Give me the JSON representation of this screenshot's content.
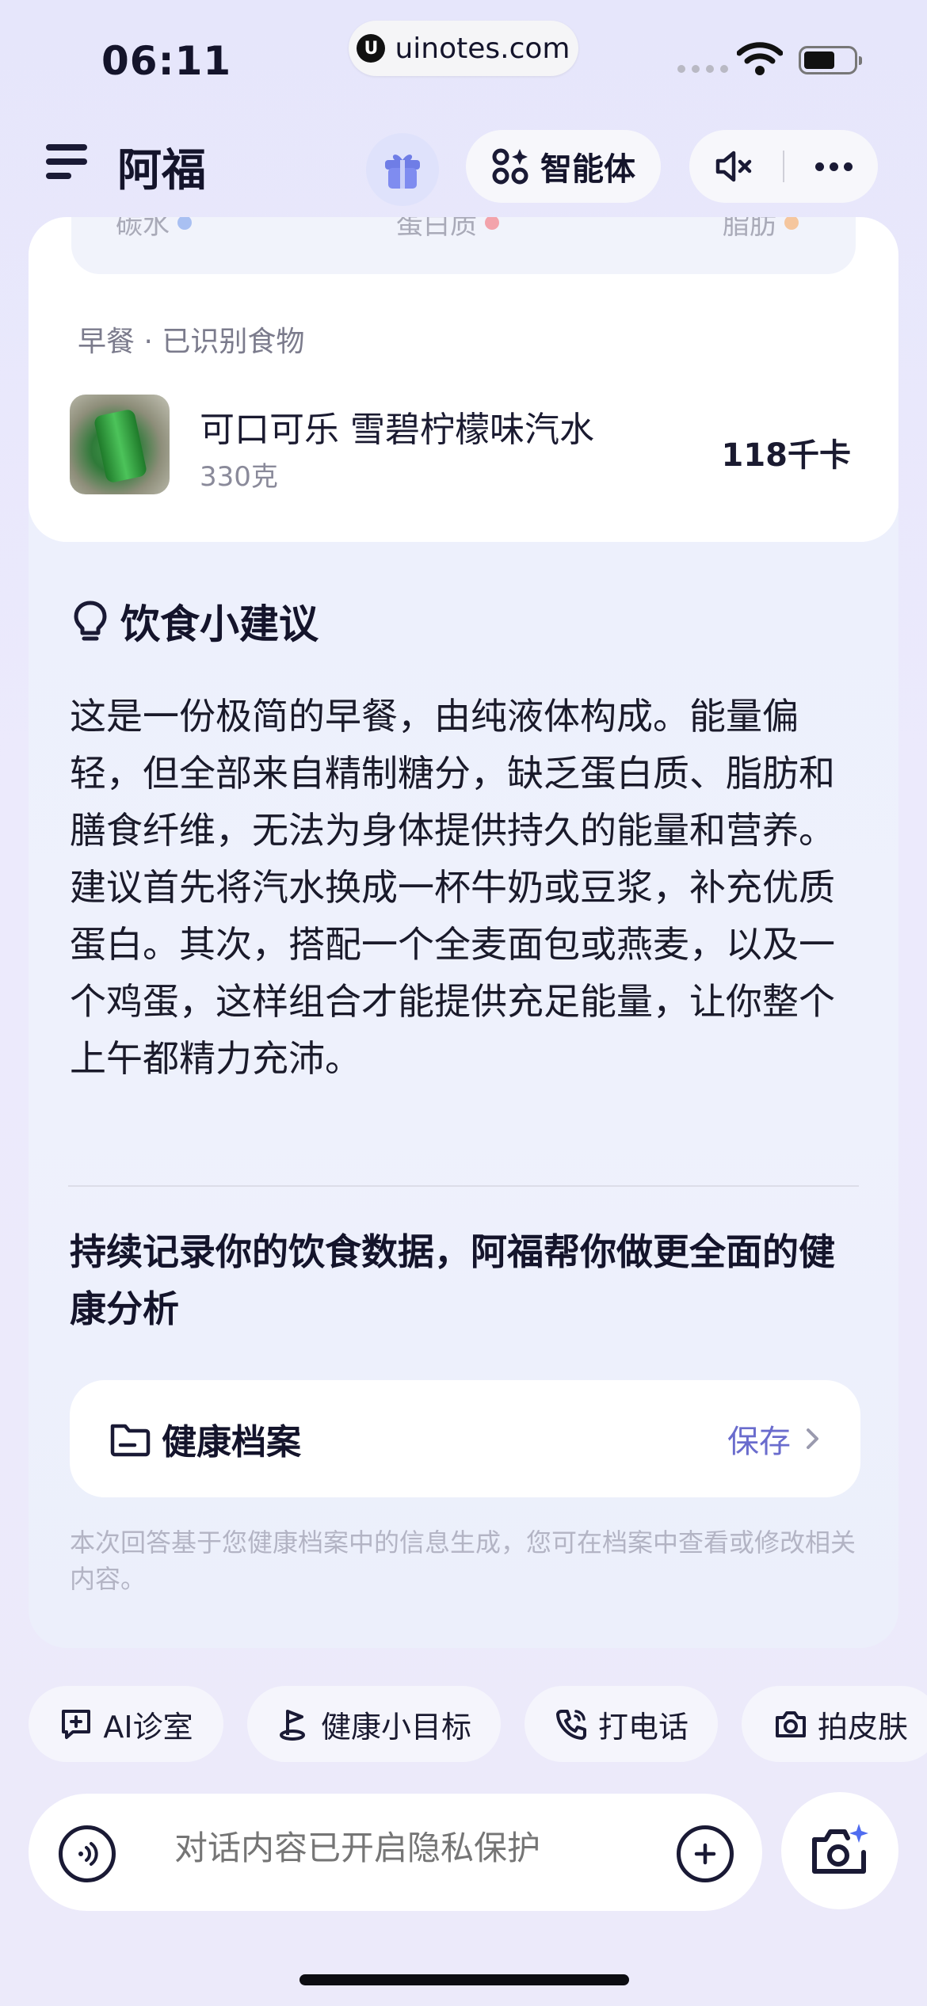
{
  "status_bar": {
    "time": "06:11",
    "url": "uinotes.com"
  },
  "header": {
    "title": "阿福",
    "agent_label": "智能体"
  },
  "nutrients": [
    {
      "label": "碳水",
      "color": "#a9c0f2"
    },
    {
      "label": "蛋白质",
      "color": "#f3a3ab"
    },
    {
      "label": "脂肪",
      "color": "#f5c69e"
    }
  ],
  "meal": {
    "label": "早餐 · 已识别食物",
    "food_name": "可口可乐 雪碧柠檬味汽水",
    "weight": "330克",
    "kcal": "118千卡"
  },
  "advice": {
    "title": "饮食小建议",
    "paragraphs": [
      "这是一份极简的早餐，由纯液体构成。能量偏轻，但全部来自精制糖分，缺乏蛋白质、脂肪和膳食纤维，无法为身体提供持久的能量和营养。",
      "建议首先将汽水换成一杯牛奶或豆浆，补充优质蛋白。其次，搭配一个全麦面包或燕麦，以及一个鸡蛋，这样组合才能提供充足能量，让你整个上午都精力充沛。"
    ]
  },
  "cta_text": "持续记录你的饮食数据，阿福帮你做更全面的健康分析",
  "record": {
    "label": "健康档案",
    "action": "保存"
  },
  "disclaimer": "本次回答基于您健康档案中的信息生成，您可在档案中查看或修改相关内容。",
  "quick_actions": [
    "AI诊室",
    "健康小目标",
    "打电话",
    "拍皮肤"
  ],
  "input": {
    "placeholder": "对话内容已开启隐私保护"
  },
  "colors": {
    "accent": "#6a6ccd",
    "text_dark": "#14142b"
  }
}
